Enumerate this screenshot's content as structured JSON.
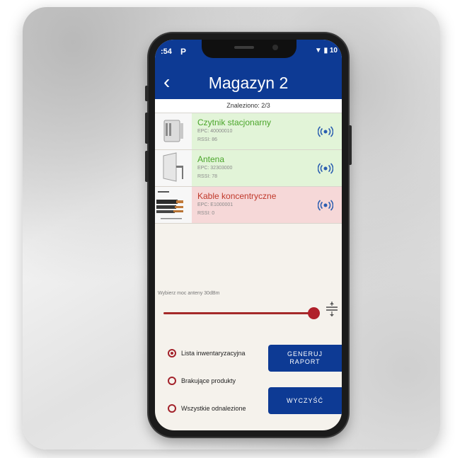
{
  "status_bar": {
    "time": ":54",
    "app_icon": "P",
    "right": "▼ ▮ 10"
  },
  "header": {
    "back_icon": "‹",
    "title": "Magazyn 2"
  },
  "found_count": "Znaleziono: 2/3",
  "items": [
    {
      "name": "Czytnik stacjonarny",
      "epc": "EPC: 40000010",
      "rssi": "RSSI: 86",
      "status": "found",
      "status_color": "#4aa52a"
    },
    {
      "name": "Antena",
      "epc": "EPC: 32303000",
      "rssi": "RSSI: 78",
      "status": "found",
      "status_color": "#4aa52a"
    },
    {
      "name": "Kable koncentryczne",
      "epc": "EPC: E1000001",
      "rssi": "RSSI: 0",
      "status": "missing",
      "status_color": "#c0392b"
    }
  ],
  "power": {
    "label": "Wybierz moc anteny 30dBm",
    "value": 30,
    "level": 0.96
  },
  "radio_options": [
    {
      "label": "Lista inwentaryzacyjna",
      "checked": true
    },
    {
      "label": "Brakujące produkty",
      "checked": false
    },
    {
      "label": "Wszystkie odnalezione",
      "checked": false
    }
  ],
  "buttons": {
    "report": "GENERUJ\nRAPORT",
    "clear": "WYCZYŚĆ"
  },
  "colors": {
    "primary": "#0d3a94",
    "accent": "#a3222b",
    "found_bg": "#e2f4d8",
    "missing_bg": "#f6d8d8"
  }
}
